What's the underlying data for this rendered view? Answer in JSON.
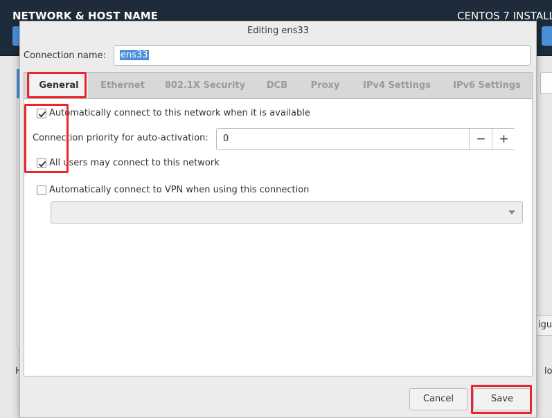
{
  "background": {
    "title": "NETWORK & HOST NAME",
    "product": "CENTOS 7 INSTALL",
    "configure_fragment": "igure",
    "left_fragment": "H",
    "right_fragment": "lo"
  },
  "dialog": {
    "title": "Editing ens33",
    "connection_name_label": "Connection name:",
    "connection_name_value": "ens33"
  },
  "tabs": [
    {
      "label": "General",
      "active": true
    },
    {
      "label": "Ethernet",
      "active": false
    },
    {
      "label": "802.1X Security",
      "active": false
    },
    {
      "label": "DCB",
      "active": false
    },
    {
      "label": "Proxy",
      "active": false
    },
    {
      "label": "IPv4 Settings",
      "active": false
    },
    {
      "label": "IPv6 Settings",
      "active": false
    }
  ],
  "general": {
    "auto_connect": {
      "label": "Automatically connect to this network when it is available",
      "checked": true
    },
    "priority": {
      "label": "Connection priority for auto-activation:",
      "value": "0",
      "minus": "−",
      "plus": "+"
    },
    "all_users": {
      "label": "All users may connect to this network",
      "checked": true
    },
    "auto_vpn": {
      "label": "Automatically connect to VPN when using this connection",
      "checked": false
    },
    "vpn_selection": ""
  },
  "buttons": {
    "cancel": "Cancel",
    "save": "Save"
  },
  "colors": {
    "annotation": "#e8262c",
    "accent": "#4a90d9"
  }
}
